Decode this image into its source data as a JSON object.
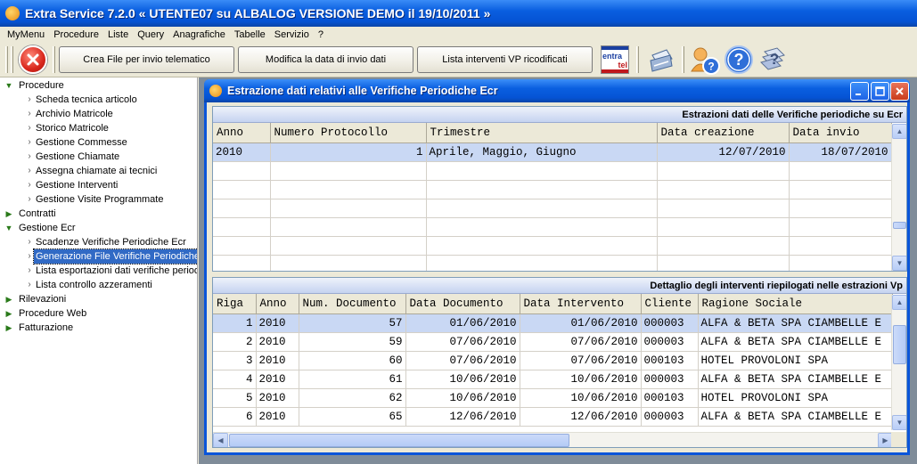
{
  "app": {
    "title": "Extra Service 7.2.0  « UTENTE07 su ALBALOG VERSIONE DEMO il 19/10/2011 »"
  },
  "menu": [
    "MyMenu",
    "Procedure",
    "Liste",
    "Query",
    "Anagrafiche",
    "Tabelle",
    "Servizio",
    "?"
  ],
  "toolbar": {
    "btn_crea": "Crea File per invio telematico",
    "btn_modifica": "Modifica la data di invio dati",
    "btn_lista": "Lista interventi VP ricodificati",
    "logo_text_1": "entra",
    "logo_text_2": "tel",
    "icons": [
      "exit-icon",
      "printer-icon",
      "user-help-icon",
      "help-icon",
      "help-book-icon"
    ]
  },
  "tree": [
    {
      "label": "Procedure",
      "level": 0,
      "expanded": true
    },
    {
      "label": "Scheda tecnica articolo",
      "level": 1
    },
    {
      "label": "Archivio Matricole",
      "level": 1
    },
    {
      "label": "Storico Matricole",
      "level": 1
    },
    {
      "label": "Gestione Commesse",
      "level": 1
    },
    {
      "label": "Gestione Chiamate",
      "level": 1
    },
    {
      "label": "Assegna chiamate ai tecnici",
      "level": 1
    },
    {
      "label": "Gestione Interventi",
      "level": 1
    },
    {
      "label": "Gestione Visite Programmate",
      "level": 1
    },
    {
      "label": "Contratti",
      "level": 0,
      "expanded": false
    },
    {
      "label": "Gestione Ecr",
      "level": 0,
      "expanded": true
    },
    {
      "label": "Scadenze Verifiche Periodiche Ecr",
      "level": 1
    },
    {
      "label": "Generazione File Verifiche Periodiche",
      "level": 1,
      "selected": true
    },
    {
      "label": "Lista esportazioni dati verifiche periodiche",
      "level": 1
    },
    {
      "label": "Lista controllo azzeramenti",
      "level": 1
    },
    {
      "label": "Rilevazioni",
      "level": 0,
      "expanded": false
    },
    {
      "label": "Procedure Web",
      "level": 0,
      "expanded": false
    },
    {
      "label": "Fatturazione",
      "level": 0,
      "expanded": false
    }
  ],
  "window": {
    "title": "Estrazione dati relativi alle Verifiche Periodiche Ecr"
  },
  "top_grid": {
    "header": "Estrazioni dati delle Verifiche periodiche su Ecr",
    "columns": [
      "Anno",
      "Numero Protocollo",
      "Trimestre",
      "Data creazione",
      "Data invio"
    ],
    "rows": [
      [
        "2010",
        "1",
        "Aprile, Maggio, Giugno",
        "12/07/2010",
        "18/07/2010"
      ]
    ]
  },
  "bottom_grid": {
    "header": "Dettaglio degli interventi riepilogati nelle estrazioni Vp",
    "columns": [
      "Riga",
      "Anno",
      "Num. Documento",
      "Data Documento",
      "Data Intervento",
      "Cliente",
      "Ragione Sociale"
    ],
    "rows": [
      [
        "1",
        "2010",
        "57",
        "01/06/2010",
        "01/06/2010",
        "000003",
        "ALFA & BETA SPA CIAMBELLE E"
      ],
      [
        "2",
        "2010",
        "59",
        "07/06/2010",
        "07/06/2010",
        "000003",
        "ALFA & BETA SPA CIAMBELLE E"
      ],
      [
        "3",
        "2010",
        "60",
        "07/06/2010",
        "07/06/2010",
        "000103",
        "HOTEL PROVOLONI SPA"
      ],
      [
        "4",
        "2010",
        "61",
        "10/06/2010",
        "10/06/2010",
        "000003",
        "ALFA & BETA SPA CIAMBELLE E"
      ],
      [
        "5",
        "2010",
        "62",
        "10/06/2010",
        "10/06/2010",
        "000103",
        "HOTEL PROVOLONI SPA"
      ],
      [
        "6",
        "2010",
        "65",
        "12/06/2010",
        "12/06/2010",
        "000003",
        "ALFA & BETA SPA CIAMBELLE E"
      ]
    ]
  }
}
